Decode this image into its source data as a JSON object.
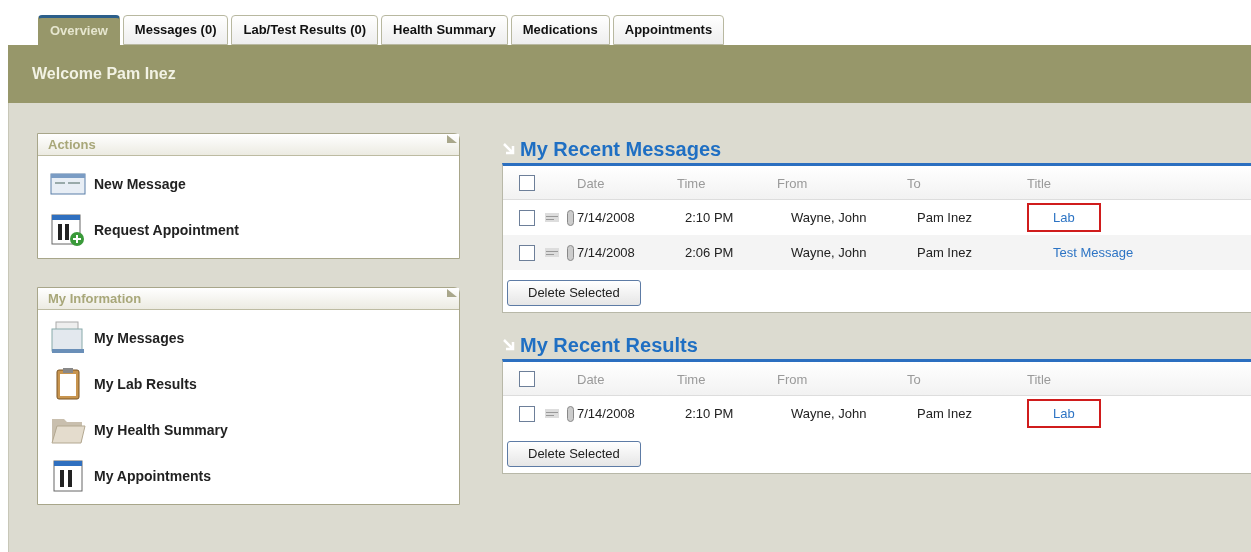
{
  "tabs": [
    {
      "label": "Overview",
      "selected": true
    },
    {
      "label": "Messages (0)",
      "selected": false
    },
    {
      "label": "Lab/Test Results (0)",
      "selected": false
    },
    {
      "label": "Health Summary",
      "selected": false
    },
    {
      "label": "Medications",
      "selected": false
    },
    {
      "label": "Appointments",
      "selected": false
    }
  ],
  "welcome": "Welcome Pam Inez",
  "panels": [
    {
      "title": "Actions",
      "items": [
        {
          "label": "New Message",
          "kind": "message"
        },
        {
          "label": "Request Appointment",
          "kind": "calendar-add"
        }
      ]
    },
    {
      "title": "My Information",
      "items": [
        {
          "label": "My Messages",
          "kind": "messages"
        },
        {
          "label": "My Lab Results",
          "kind": "clipboard"
        },
        {
          "label": "My Health Summary",
          "kind": "folder"
        },
        {
          "label": "My Appointments",
          "kind": "calendar"
        }
      ]
    }
  ],
  "sections": [
    {
      "title": "My Recent Messages",
      "select_all_checked": false,
      "columns": [
        "Date",
        "Time",
        "From",
        "To",
        "Title"
      ],
      "rows": [
        {
          "checked": false,
          "date": "7/14/2008",
          "time": "2:10 PM",
          "from": "Wayne, John",
          "to": "Pam Inez",
          "title": "Lab",
          "highlighted": true
        },
        {
          "checked": false,
          "date": "7/14/2008",
          "time": "2:06 PM",
          "from": "Wayne, John",
          "to": "Pam Inez",
          "title": "Test Message",
          "highlighted": false
        }
      ],
      "button": "Delete Selected"
    },
    {
      "title": "My Recent Results",
      "select_all_checked": false,
      "columns": [
        "Date",
        "Time",
        "From",
        "To",
        "Title"
      ],
      "rows": [
        {
          "checked": false,
          "date": "7/14/2008",
          "time": "2:10 PM",
          "from": "Wayne, John",
          "to": "Pam Inez",
          "title": "Lab",
          "highlighted": true
        }
      ],
      "button": "Delete Selected"
    }
  ]
}
